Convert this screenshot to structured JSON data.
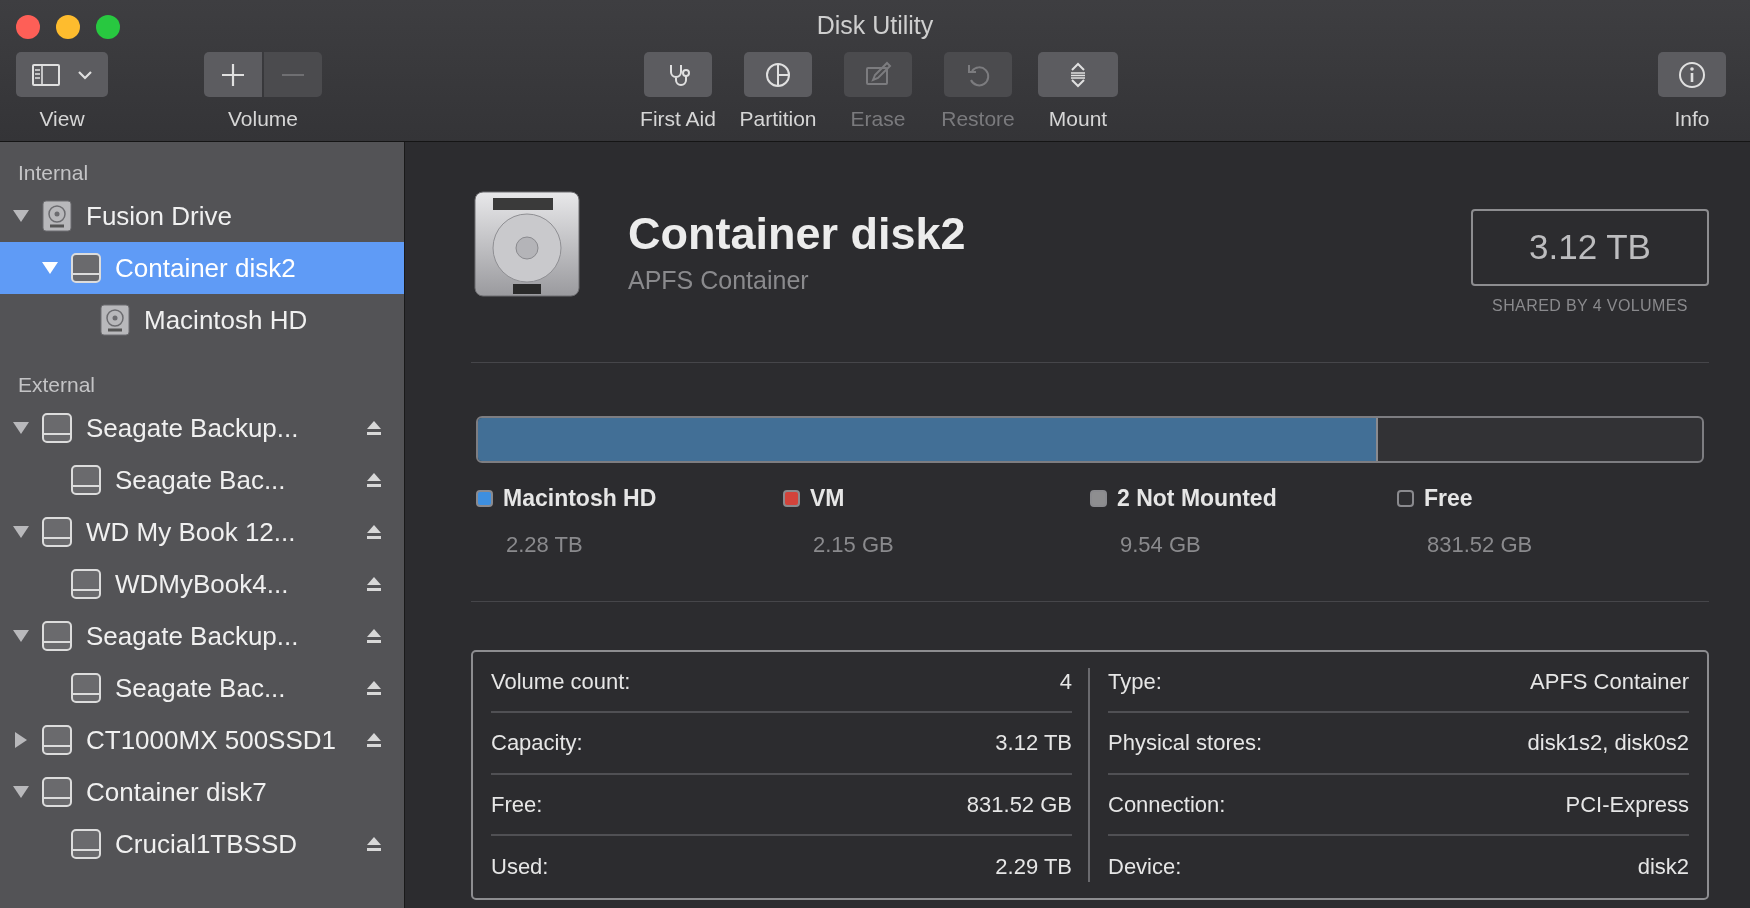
{
  "window": {
    "title": "Disk Utility"
  },
  "toolbar": {
    "left": [
      {
        "kind": "view",
        "label": "View",
        "disabled": false
      },
      {
        "kind": "volume",
        "label": "Volume",
        "disabled": false,
        "remove_disabled": true
      }
    ],
    "center": [
      {
        "kind": "first_aid",
        "label": "First Aid",
        "disabled": false
      },
      {
        "kind": "partition",
        "label": "Partition",
        "disabled": false
      },
      {
        "kind": "erase",
        "label": "Erase",
        "disabled": true
      },
      {
        "kind": "restore",
        "label": "Restore",
        "disabled": true
      },
      {
        "kind": "mount",
        "label": "Mount",
        "disabled": false
      }
    ],
    "right": [
      {
        "kind": "info",
        "label": "Info",
        "disabled": false
      }
    ]
  },
  "sidebar": {
    "sections": [
      {
        "title": "Internal",
        "items": [
          {
            "name": "Fusion Drive",
            "kind": "hdd",
            "has_disclosure": true,
            "expanded": true,
            "selected": false,
            "ejectable": false,
            "children": [
              {
                "name": "Container disk2",
                "kind": "drive",
                "has_disclosure": true,
                "expanded": true,
                "selected": true,
                "ejectable": false,
                "children": [
                  {
                    "name": "Macintosh HD",
                    "kind": "hdd",
                    "has_disclosure": false,
                    "expanded": false,
                    "selected": false,
                    "ejectable": false
                  }
                ]
              }
            ]
          }
        ]
      },
      {
        "title": "External",
        "items": [
          {
            "name": "Seagate Backup...",
            "kind": "drive",
            "has_disclosure": true,
            "expanded": true,
            "selected": false,
            "ejectable": true,
            "children": [
              {
                "name": "Seagate Bac...",
                "kind": "drive",
                "has_disclosure": false,
                "expanded": false,
                "selected": false,
                "ejectable": true
              }
            ]
          },
          {
            "name": "WD My Book 12...",
            "kind": "drive",
            "has_disclosure": true,
            "expanded": true,
            "selected": false,
            "ejectable": true,
            "children": [
              {
                "name": "WDMyBook4...",
                "kind": "drive",
                "has_disclosure": false,
                "expanded": false,
                "selected": false,
                "ejectable": true
              }
            ]
          },
          {
            "name": "Seagate Backup...",
            "kind": "drive",
            "has_disclosure": true,
            "expanded": true,
            "selected": false,
            "ejectable": true,
            "children": [
              {
                "name": "Seagate Bac...",
                "kind": "drive",
                "has_disclosure": false,
                "expanded": false,
                "selected": false,
                "ejectable": true
              }
            ]
          },
          {
            "name": "CT1000MX 500SSD1",
            "kind": "drive",
            "has_disclosure": true,
            "expanded": false,
            "selected": false,
            "ejectable": true
          },
          {
            "name": "Container disk7",
            "kind": "drive",
            "has_disclosure": true,
            "expanded": true,
            "selected": false,
            "ejectable": false,
            "children": [
              {
                "name": "Crucial1TBSSD",
                "kind": "drive",
                "has_disclosure": false,
                "expanded": false,
                "selected": false,
                "ejectable": true
              }
            ]
          }
        ]
      }
    ]
  },
  "header": {
    "title": "Container disk2",
    "subtitle": "APFS Container",
    "capacity": "3.12 TB",
    "capacity_note": "SHARED BY 4 VOLUMES"
  },
  "usage": {
    "level": 0.735
  },
  "legend": [
    {
      "label": "Macintosh HD",
      "value": "2.28 TB",
      "color": "#3d8fe0"
    },
    {
      "label": "VM",
      "value": "2.15 GB",
      "color": "#d2433b"
    },
    {
      "label": "2 Not Mounted",
      "value": "9.54 GB",
      "color": "#8e8e90"
    },
    {
      "label": "Free",
      "value": "831.52 GB",
      "color": "#2e2e31"
    }
  ],
  "details": {
    "left": [
      {
        "label": "Volume count:",
        "value": "4"
      },
      {
        "label": "Capacity:",
        "value": "3.12 TB"
      },
      {
        "label": "Free:",
        "value": "831.52 GB"
      },
      {
        "label": "Used:",
        "value": "2.29 TB"
      }
    ],
    "right": [
      {
        "label": "Type:",
        "value": "APFS Container"
      },
      {
        "label": "Physical stores:",
        "value": "disk1s2, disk0s2"
      },
      {
        "label": "Connection:",
        "value": "PCI-Express"
      },
      {
        "label": "Device:",
        "value": "disk2"
      }
    ]
  }
}
